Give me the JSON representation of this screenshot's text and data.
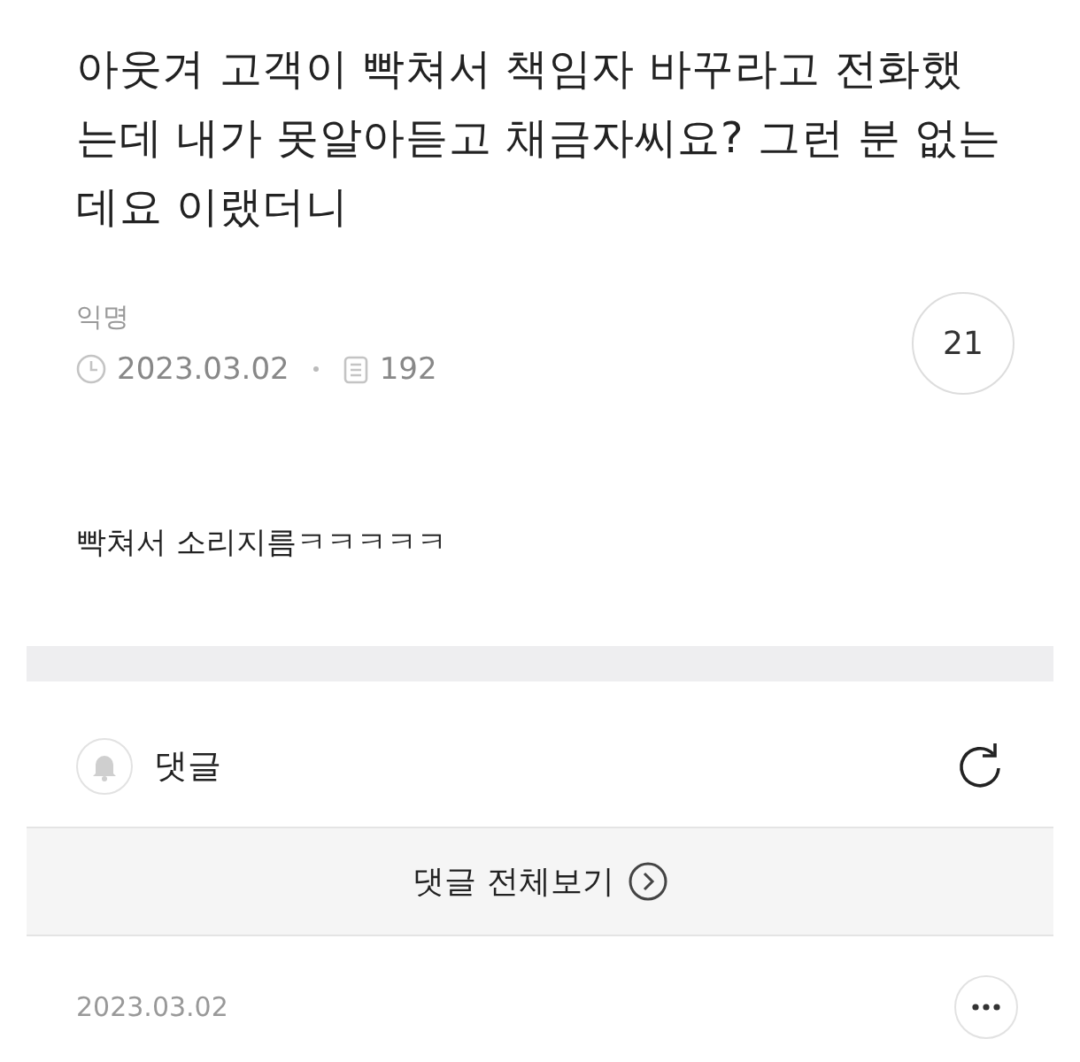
{
  "post": {
    "title": "아웃겨 고객이 빡쳐서 책임자 바꾸라고 전화했는데 내가 못알아듣고 채금자씨요? 그런 분 없는데요 이랬더니",
    "author": "익명",
    "date": "2023.03.02",
    "views": "192",
    "comment_count": "21",
    "body": "빡쳐서 소리지름ㅋㅋㅋㅋㅋ"
  },
  "comments": {
    "label": "댓글",
    "view_all": "댓글 전체보기",
    "items": [
      {
        "date": "2023.03.02"
      }
    ]
  }
}
